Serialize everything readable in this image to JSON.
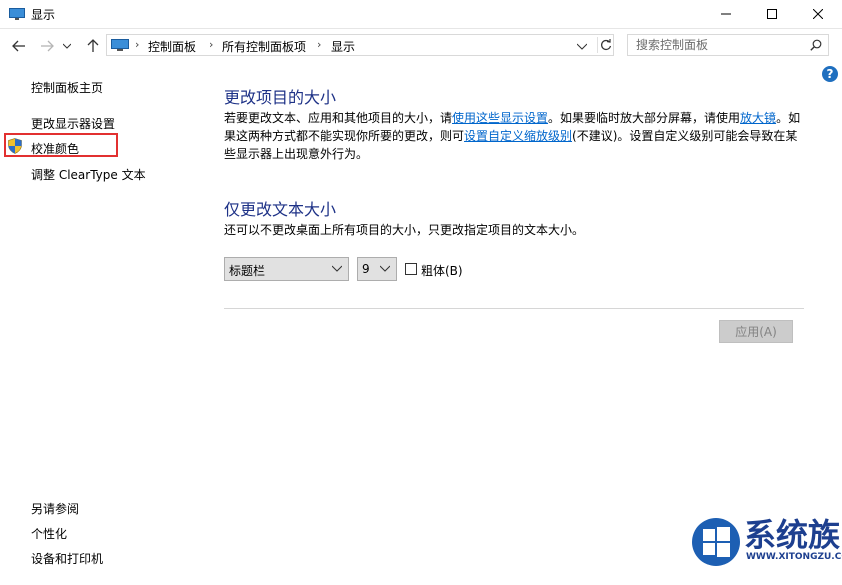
{
  "window": {
    "title": "显示"
  },
  "address_bar": {
    "breadcrumbs": [
      "控制面板",
      "所有控制面板项",
      "显示"
    ],
    "search_placeholder": "搜索控制面板"
  },
  "help": {
    "label": "?"
  },
  "left_nav": {
    "home": "控制面板主页",
    "items": [
      "更改显示器设置",
      "校准颜色",
      "调整 ClearType 文本"
    ],
    "see_also_title": "另请参阅",
    "see_also_items": [
      "个性化",
      "设备和打印机"
    ]
  },
  "main": {
    "section1": {
      "title": "更改项目的大小",
      "line1_pre": "若要更改文本、应用和其他项目的大小，请",
      "line1_link1": "使用这些显示设置",
      "line1_mid": "。如果要临时放大部分屏幕，请使用",
      "line1_link2": "放大镜",
      "line1_post": "。如",
      "line2_pre": "果这两种方式都不能实现你所要的更改，则可",
      "line2_link": "设置自定义缩放级别",
      "line2_post": "(不建议)。设置自定义级别可能会导致在某",
      "line3": "些显示器上出现意外行为。"
    },
    "section2": {
      "title": "仅更改文本大小",
      "description": "还可以不更改桌面上所有项目的大小，只更改指定项目的文本大小。",
      "item_select_value": "标题栏",
      "size_select_value": "9",
      "bold_label": "粗体(B)",
      "bold_checked": false
    },
    "apply_label": "应用(A)"
  },
  "watermark": {
    "brand": "系统族",
    "url": "WWW.XITONGZU.COM"
  },
  "colors": {
    "heading": "#1e3287",
    "link": "#0066cc",
    "highlight": "#e23030"
  }
}
